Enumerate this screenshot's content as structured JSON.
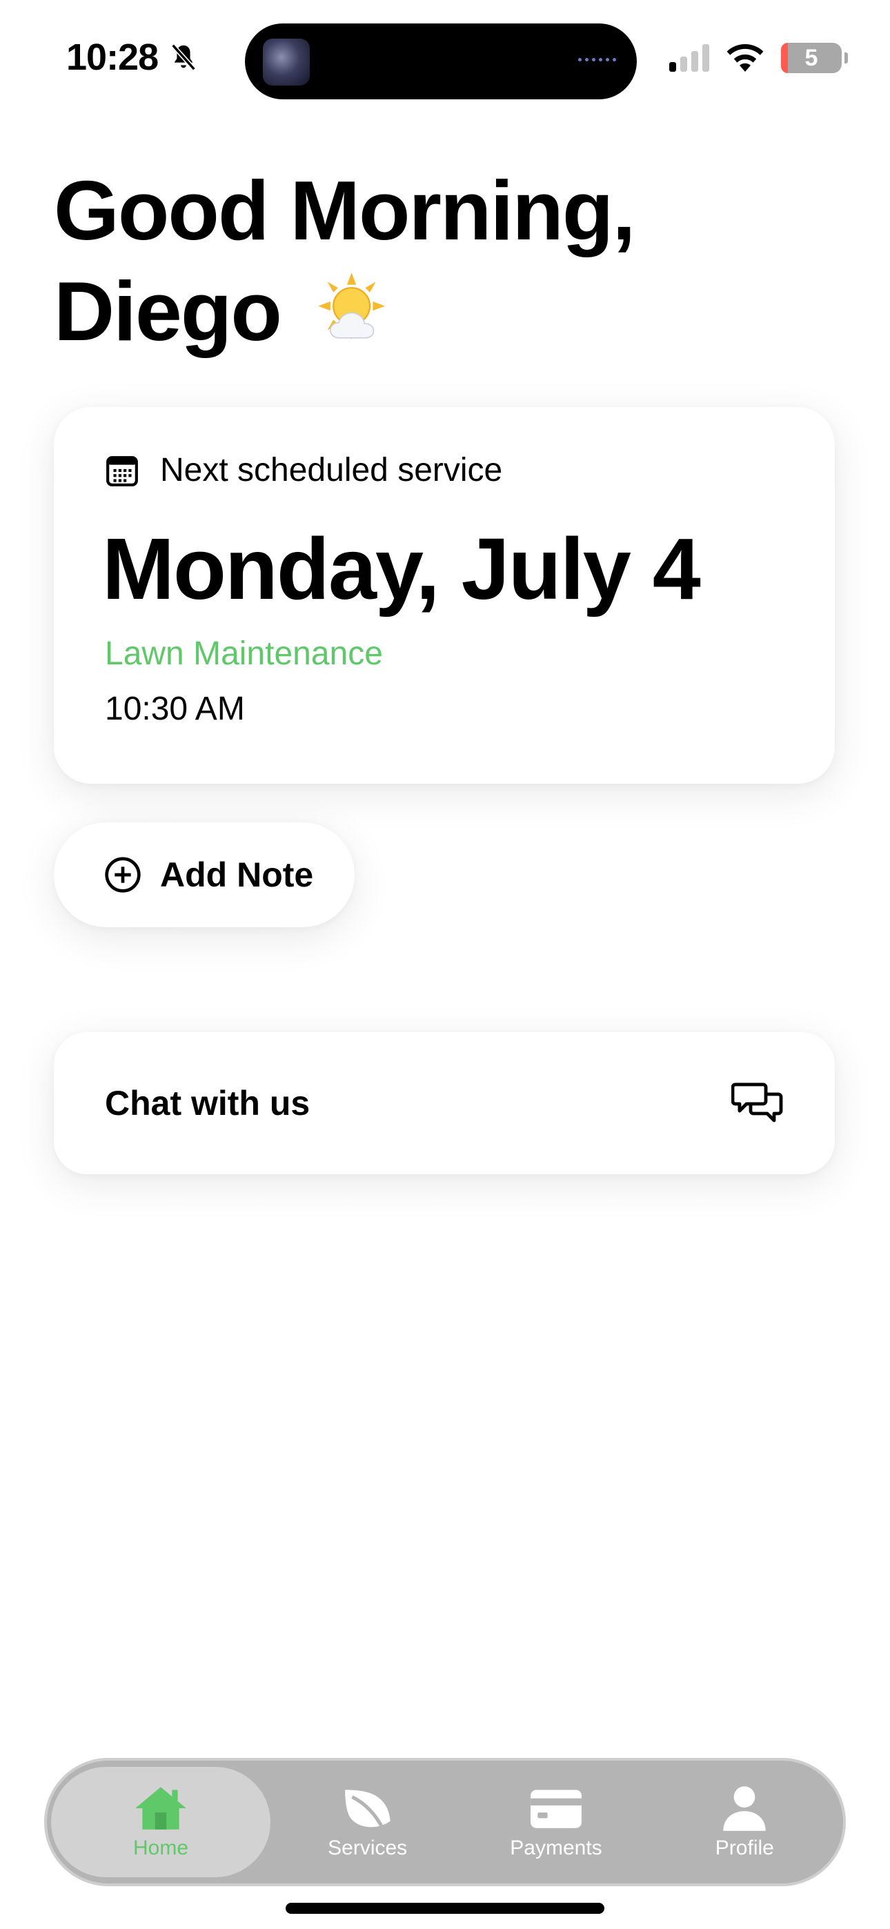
{
  "status_bar": {
    "time": "10:28",
    "battery_level": "5",
    "signal_bars_on": 1,
    "signal_bars_total": 4
  },
  "greeting": {
    "line1": "Good Morning,",
    "name": "Diego",
    "weather_icon": "sun-behind-cloud-icon"
  },
  "next_service": {
    "header": "Next scheduled service",
    "date": "Monday, July 4",
    "service_type": "Lawn Maintenance",
    "time": "10:30 AM"
  },
  "add_note": {
    "label": "Add Note"
  },
  "chat": {
    "label": "Chat with us"
  },
  "tab_bar": {
    "tabs": [
      {
        "label": "Home",
        "icon": "home-icon",
        "active": true
      },
      {
        "label": "Services",
        "icon": "leaf-icon",
        "active": false
      },
      {
        "label": "Payments",
        "icon": "credit-card-icon",
        "active": false
      },
      {
        "label": "Profile",
        "icon": "person-icon",
        "active": false
      }
    ]
  },
  "colors": {
    "accent_green": "#5fc96a",
    "tab_bar_bg": "#b4b4b4",
    "active_tab_bg": "#d2d2d2"
  }
}
